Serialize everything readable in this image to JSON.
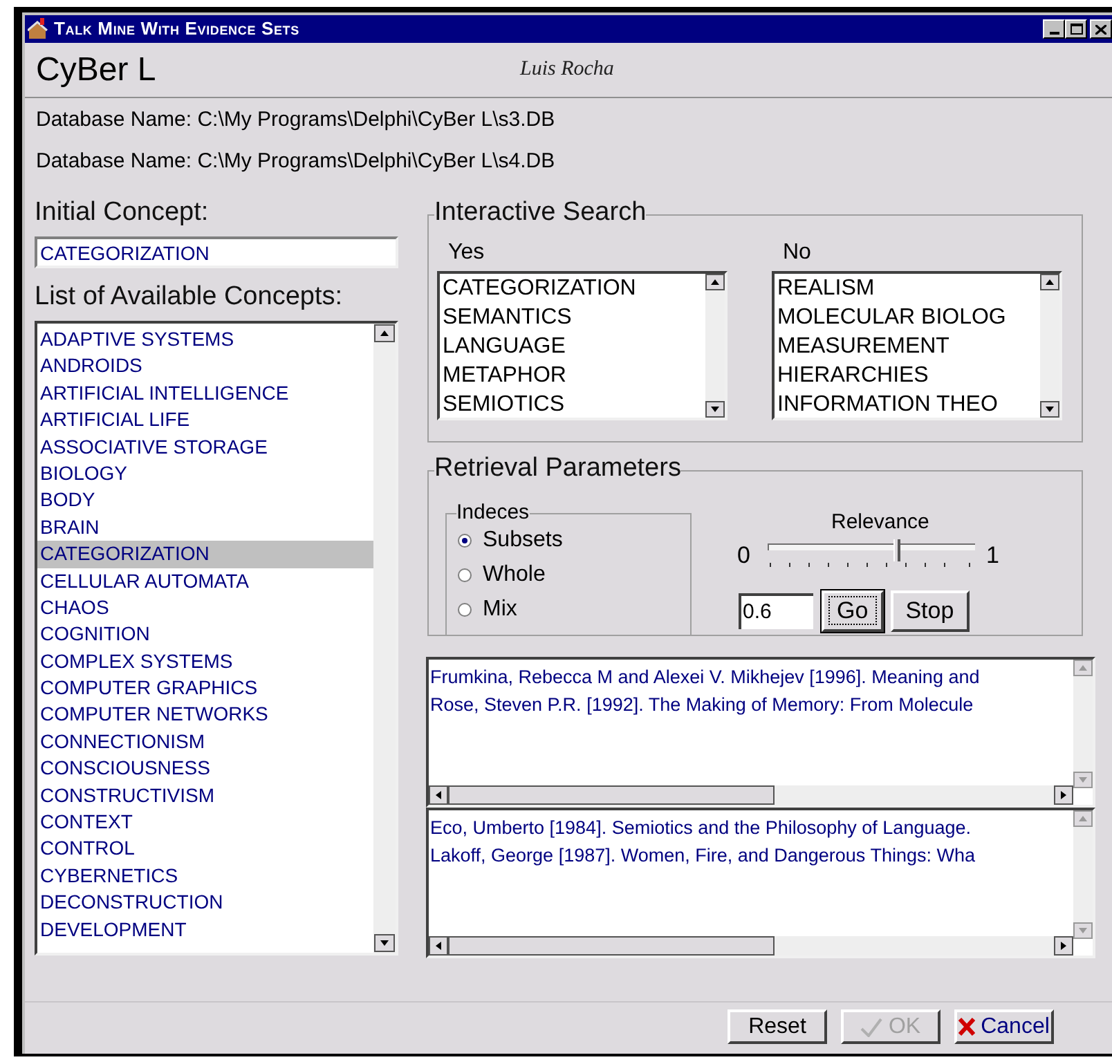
{
  "window": {
    "title": "Talk Mine With Evidence Sets"
  },
  "header": {
    "app_name": "CyBer L",
    "author": "Luis Rocha"
  },
  "databases": [
    "Database Name: C:\\My Programs\\Delphi\\CyBer L\\s3.DB",
    "Database Name: C:\\My Programs\\Delphi\\CyBer L\\s4.DB"
  ],
  "initial_concept": {
    "label": "Initial Concept:",
    "value": "CATEGORIZATION"
  },
  "concepts": {
    "label": "List of Available Concepts:",
    "items": [
      {
        "text": "ADAPTIVE SYSTEMS",
        "selected": false
      },
      {
        "text": "ANDROIDS",
        "selected": false
      },
      {
        "text": "ARTIFICIAL INTELLIGENCE",
        "selected": false
      },
      {
        "text": "ARTIFICIAL LIFE",
        "selected": false
      },
      {
        "text": "ASSOCIATIVE STORAGE",
        "selected": false
      },
      {
        "text": "BIOLOGY",
        "selected": false
      },
      {
        "text": "BODY",
        "selected": false
      },
      {
        "text": "BRAIN",
        "selected": false
      },
      {
        "text": "CATEGORIZATION",
        "selected": true
      },
      {
        "text": "CELLULAR AUTOMATA",
        "selected": false
      },
      {
        "text": "CHAOS",
        "selected": false
      },
      {
        "text": "COGNITION",
        "selected": false
      },
      {
        "text": "COMPLEX SYSTEMS",
        "selected": false
      },
      {
        "text": "COMPUTER GRAPHICS",
        "selected": false
      },
      {
        "text": "COMPUTER NETWORKS",
        "selected": false
      },
      {
        "text": "CONNECTIONISM",
        "selected": false
      },
      {
        "text": "CONSCIOUSNESS",
        "selected": false
      },
      {
        "text": "CONSTRUCTIVISM",
        "selected": false
      },
      {
        "text": "CONTEXT",
        "selected": false
      },
      {
        "text": "CONTROL",
        "selected": false
      },
      {
        "text": "CYBERNETICS",
        "selected": false
      },
      {
        "text": "DECONSTRUCTION",
        "selected": false
      },
      {
        "text": "DEVELOPMENT",
        "selected": false
      }
    ]
  },
  "interactive_search": {
    "title": "Interactive Search",
    "yes": {
      "label": "Yes",
      "items": [
        "CATEGORIZATION",
        "SEMANTICS",
        "LANGUAGE",
        "METAPHOR",
        "SEMIOTICS"
      ]
    },
    "no": {
      "label": "No",
      "items": [
        "REALISM",
        "MOLECULAR BIOLOG",
        "MEASUREMENT",
        "HIERARCHIES",
        "INFORMATION THEO"
      ]
    }
  },
  "retrieval": {
    "title": "Retrieval Parameters",
    "indeces": {
      "title": "Indeces",
      "options": [
        {
          "label": "Subsets",
          "selected": true
        },
        {
          "label": "Whole",
          "selected": false
        },
        {
          "label": "Mix",
          "selected": false
        }
      ]
    },
    "relevance": {
      "label": "Relevance",
      "min": "0",
      "max": "1",
      "level": 0.63,
      "value": "0.6"
    },
    "buttons": [
      {
        "label": "Go",
        "focused": true
      },
      {
        "label": "Stop",
        "focused": false
      }
    ]
  },
  "results": [
    [
      "Frumkina, Rebecca M and Alexei V. Mikhejev [1996]. Meaning and",
      "Rose, Steven P.R. [1992]. The Making of Memory: From Molecule"
    ],
    [
      "Eco, Umberto [1984]. Semiotics and the Philosophy of Language.",
      "Lakoff, George [1987]. Women, Fire, and Dangerous Things: Wha"
    ]
  ],
  "dialog_buttons": [
    {
      "kind": "reset",
      "label": "Reset",
      "disabled": false
    },
    {
      "kind": "ok",
      "label": "OK",
      "disabled": true
    },
    {
      "kind": "cancel",
      "label": "Cancel",
      "disabled": false
    }
  ]
}
